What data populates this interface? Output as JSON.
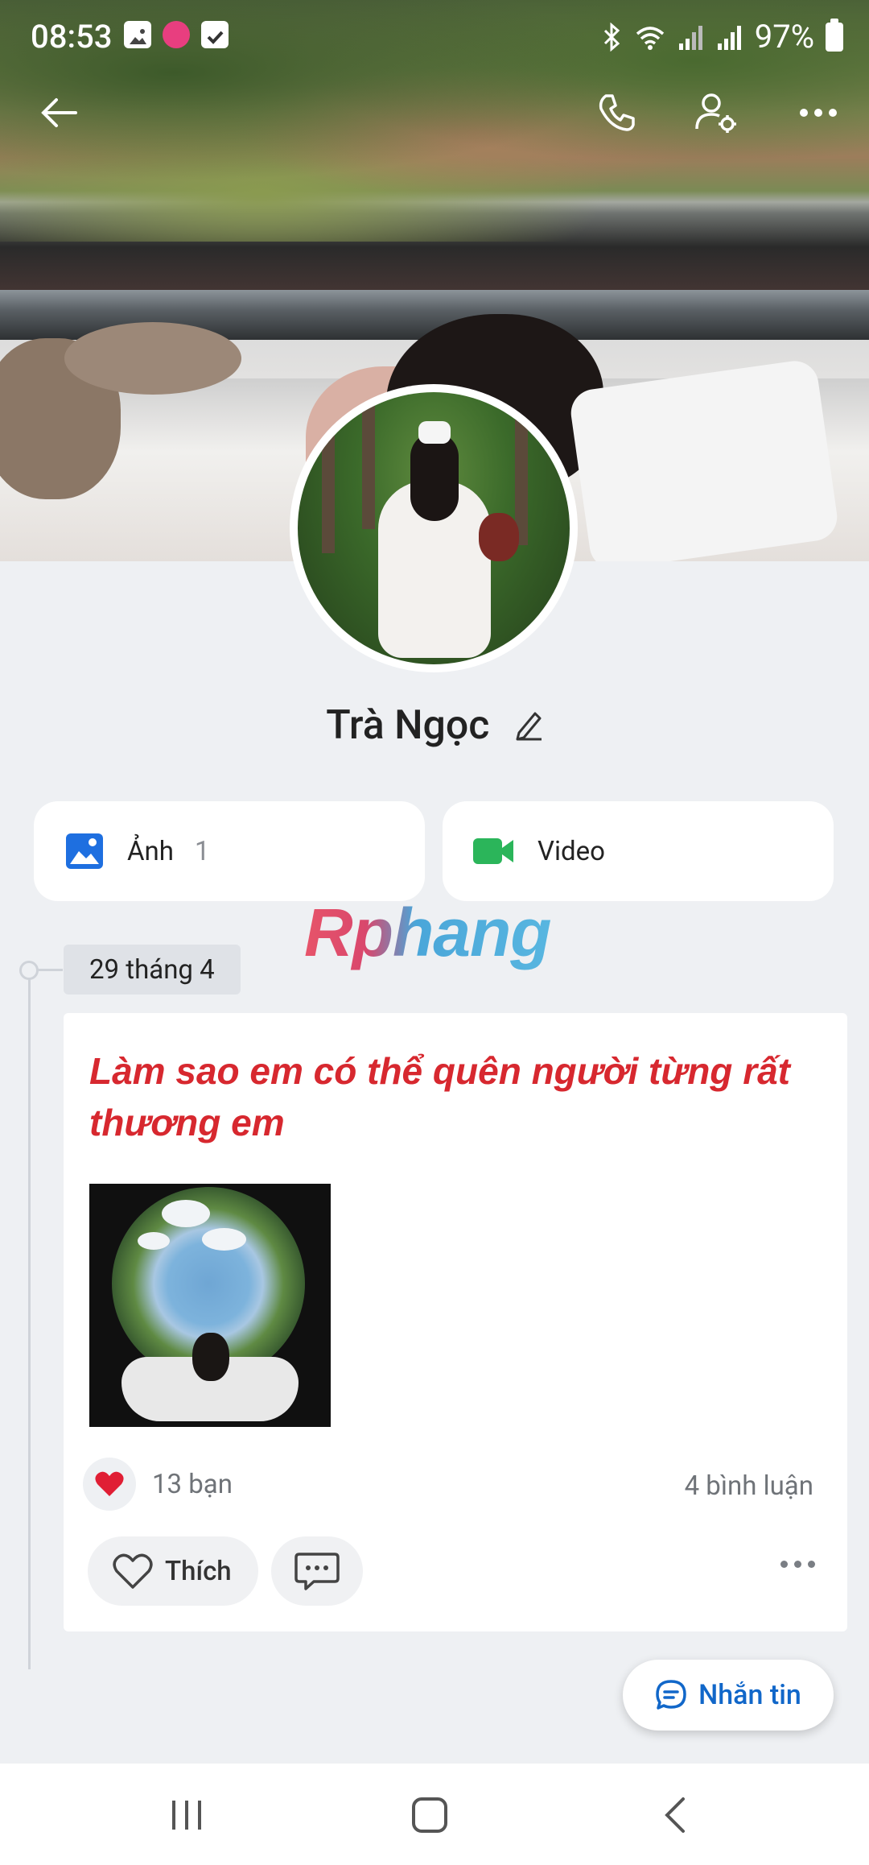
{
  "status_bar": {
    "time": "08:53",
    "battery": "97%"
  },
  "top_nav": {
    "back_icon": "arrow-left-icon",
    "call_icon": "phone-icon",
    "settings_icon": "user-settings-icon",
    "more_icon": "more-horizontal-icon"
  },
  "profile": {
    "name": "Trà Ngọc"
  },
  "media": [
    {
      "label": "Ảnh",
      "count": "1",
      "icon": "image-icon",
      "color": "#1e6fe0"
    },
    {
      "label": "Video",
      "count": "",
      "icon": "video-icon",
      "color": "#2bb55a"
    }
  ],
  "watermark": "Rphang",
  "timeline": {
    "date": "29 tháng 4"
  },
  "post": {
    "text": "Làm sao em có thể quên người từng rất thương em",
    "text_color": "#d7282f",
    "reaction_count": "13 bạn",
    "comments": "4 bình luận",
    "like_label": "Thích",
    "comment_icon": "comment-icon",
    "more_icon": "more-horizontal-icon"
  },
  "message_button": {
    "label": "Nhắn tin",
    "color": "#1167c9"
  },
  "system_nav": {
    "recents": "recents-icon",
    "home": "home-icon",
    "back": "back-chevron-icon"
  }
}
